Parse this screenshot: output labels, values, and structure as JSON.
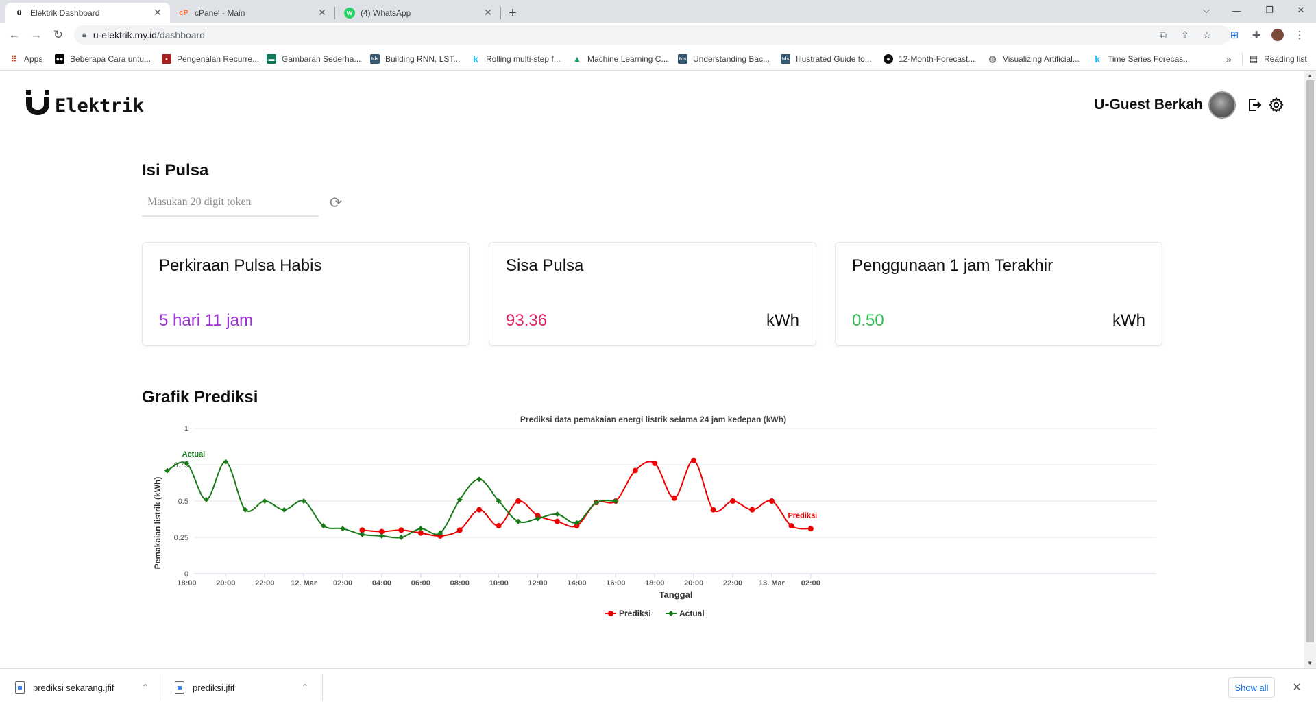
{
  "browser": {
    "tabs": [
      {
        "title": "Elektrik Dashboard",
        "favicon": "ü",
        "active": true
      },
      {
        "title": "cPanel - Main",
        "favicon": "cP",
        "active": false
      },
      {
        "title": "(4) WhatsApp",
        "favicon": "w",
        "active": false
      }
    ],
    "url_host": "u-elektrik.my.id",
    "url_path": "/dashboard",
    "bookmarks": [
      {
        "label": "Apps",
        "icon": "apps-grid-icon"
      },
      {
        "label": "Beberapa Cara untu...",
        "icon": "medium-icon"
      },
      {
        "label": "Pengenalan Recurre...",
        "icon": "bookmark-icon"
      },
      {
        "label": "Gambaran Sederha...",
        "icon": "bookmark-icon"
      },
      {
        "label": "Building RNN, LST...",
        "icon": "tds-icon"
      },
      {
        "label": "Rolling multi-step f...",
        "icon": "kaggle-icon"
      },
      {
        "label": "Machine Learning C...",
        "icon": "drive-icon"
      },
      {
        "label": "Understanding Bac...",
        "icon": "tds-icon"
      },
      {
        "label": "Illustrated Guide to...",
        "icon": "tds-icon"
      },
      {
        "label": "12-Month-Forecast...",
        "icon": "github-icon"
      },
      {
        "label": "Visualizing Artificial...",
        "icon": "globe-icon"
      },
      {
        "label": "Time Series Forecas...",
        "icon": "kaggle-icon"
      }
    ],
    "bookmarks_overflow": "»",
    "reading_list": "Reading list"
  },
  "header": {
    "brand": "Elektrik",
    "user_name": "U-Guest Berkah"
  },
  "token": {
    "title": "Isi Pulsa",
    "placeholder": "Masukan 20 digit token"
  },
  "cards": [
    {
      "title": "Perkiraan Pulsa Habis",
      "value": "5 hari 11 jam",
      "unit": "",
      "color": "#9b2fd9"
    },
    {
      "title": "Sisa Pulsa",
      "value": "93.36",
      "unit": "kWh",
      "color": "#e0245e"
    },
    {
      "title": "Penggunaan 1 jam Terakhir",
      "value": "0.50",
      "unit": "kWh",
      "color": "#2ebc4f"
    }
  ],
  "chart_section_title": "Grafik Prediksi",
  "chart_data": {
    "type": "line",
    "title": "Prediksi data pemakaian energi listrik selama 24 jam kedepan (kWh)",
    "xlabel": "Tanggal",
    "ylabel": "Pemakaian listrik (kWh)",
    "ylim": [
      0,
      1
    ],
    "yticks": [
      "0",
      "0.25",
      "0.5",
      "0.75",
      "1"
    ],
    "xticks": [
      "18:00",
      "20:00",
      "22:00",
      "12. Mar",
      "02:00",
      "04:00",
      "06:00",
      "08:00",
      "10:00",
      "12:00",
      "14:00",
      "16:00",
      "18:00",
      "20:00",
      "22:00",
      "13. Mar",
      "02:00"
    ],
    "x_start": "11 Mar 17:00",
    "x_step": "1 jam",
    "grid": true,
    "legend_position": "bottom-center",
    "series": [
      {
        "name": "Prediksi",
        "color": "#ee0000",
        "start_index": 10,
        "values": [
          0.3,
          0.29,
          0.3,
          0.28,
          0.26,
          0.3,
          0.44,
          0.33,
          0.5,
          0.4,
          0.36,
          0.33,
          0.49,
          0.5,
          0.71,
          0.76,
          0.52,
          0.78,
          0.44,
          0.5,
          0.44,
          0.5,
          0.33,
          0.31
        ],
        "end_label": "Prediksi"
      },
      {
        "name": "Actual",
        "color": "#1a7a1a",
        "start_index": 0,
        "values": [
          0.71,
          0.76,
          0.51,
          0.77,
          0.44,
          0.5,
          0.44,
          0.5,
          0.33,
          0.31,
          0.27,
          0.26,
          0.25,
          0.31,
          0.28,
          0.51,
          0.65,
          0.5,
          0.36,
          0.38,
          0.41,
          0.35,
          0.49,
          0.5
        ],
        "start_label": "Actual"
      }
    ]
  },
  "downloads": [
    {
      "name": "prediksi sekarang.jfif"
    },
    {
      "name": "prediksi.jfif"
    }
  ],
  "download_show_all": "Show all"
}
